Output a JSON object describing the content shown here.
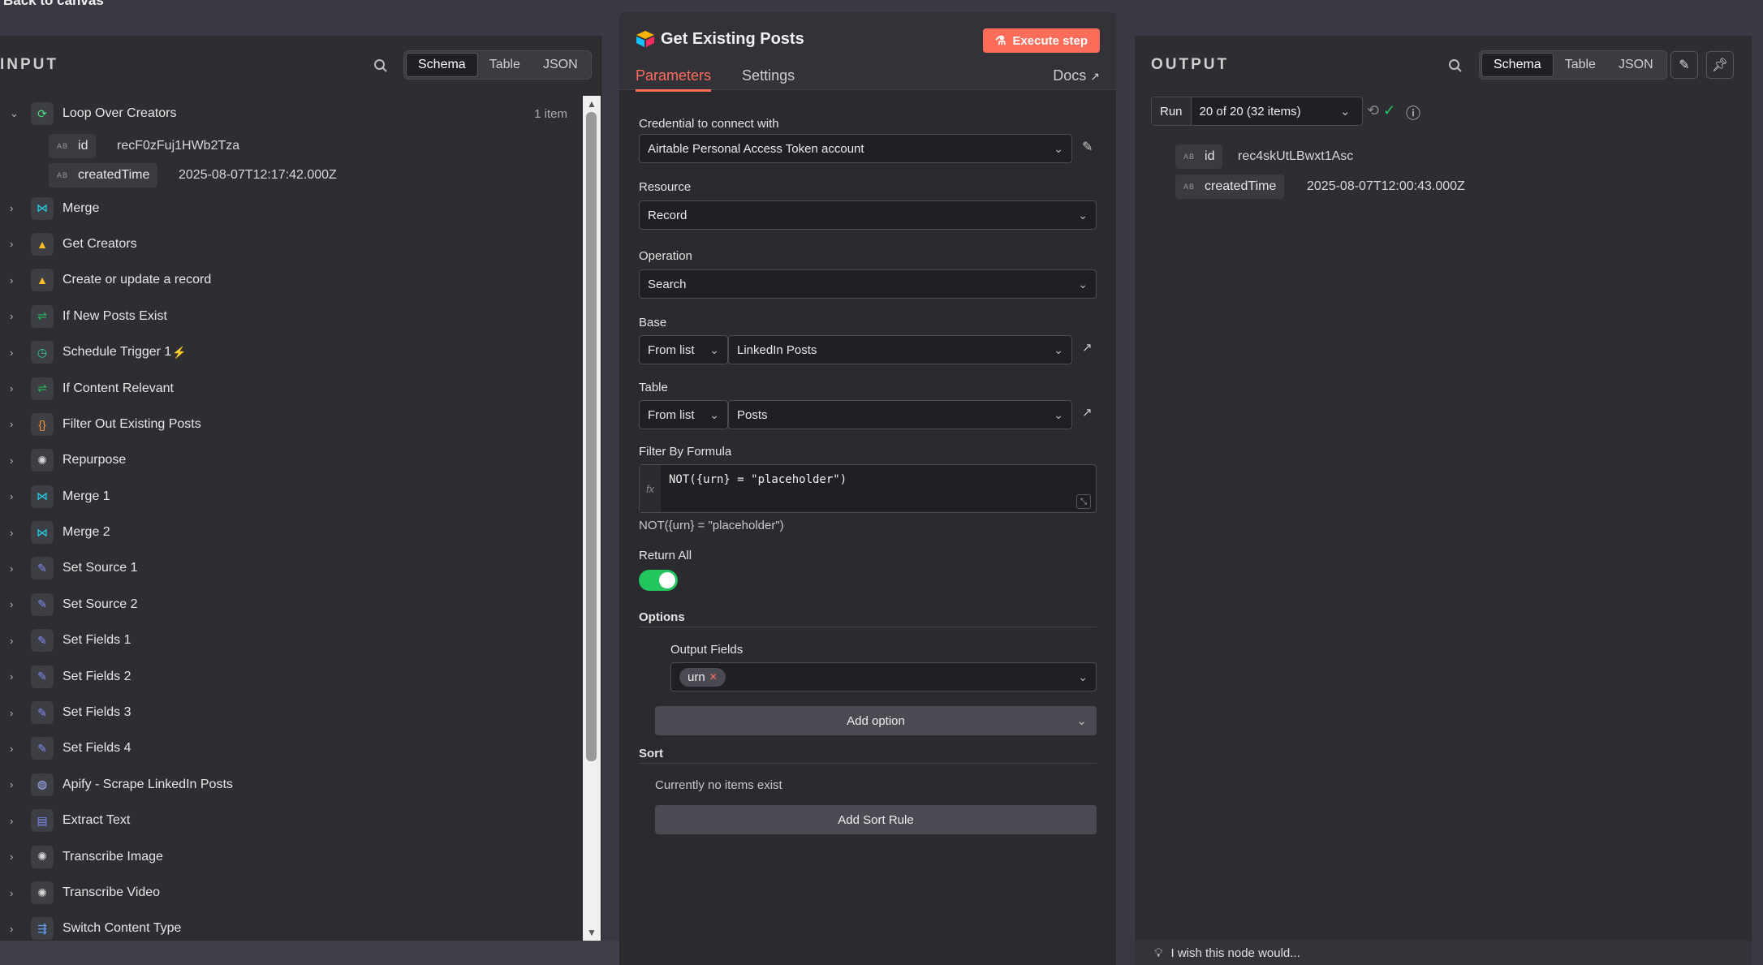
{
  "back_link": "Back to canvas",
  "input": {
    "title": "INPUT",
    "view_tabs": [
      "Schema",
      "Table",
      "JSON"
    ],
    "active_view": "Schema",
    "nodes": [
      {
        "label": "Loop Over Creators",
        "count": "1 item",
        "expanded": true,
        "icon": "loop-icon",
        "color": "#4ade80",
        "fields": [
          {
            "type": "AB",
            "name": "id",
            "value": "recF0zFuj1HWb2Tza"
          },
          {
            "type": "AB",
            "name": "createdTime",
            "value": "2025-08-07T12:17:42.000Z"
          }
        ]
      },
      {
        "label": "Merge",
        "icon": "merge-icon",
        "color": "#22d3ee"
      },
      {
        "label": "Get Creators",
        "icon": "airtable-icon",
        "color": "#fbbf24"
      },
      {
        "label": "Create or update a record",
        "icon": "airtable-icon",
        "color": "#fbbf24"
      },
      {
        "label": "If New Posts Exist",
        "icon": "if-icon",
        "color": "#22c55e"
      },
      {
        "label": "Schedule Trigger 1",
        "icon": "clock-icon",
        "color": "#34d399",
        "trigger": true
      },
      {
        "label": "If Content Relevant",
        "icon": "if-icon",
        "color": "#22c55e"
      },
      {
        "label": "Filter Out Existing Posts",
        "icon": "code-icon",
        "color": "#fb923c"
      },
      {
        "label": "Repurpose",
        "icon": "openai-icon",
        "color": "#d4d4d4"
      },
      {
        "label": "Merge 1",
        "icon": "merge-icon",
        "color": "#22d3ee"
      },
      {
        "label": "Merge 2",
        "icon": "merge-icon",
        "color": "#22d3ee"
      },
      {
        "label": "Set Source 1",
        "icon": "pencil-icon",
        "color": "#818cf8"
      },
      {
        "label": "Set Source 2",
        "icon": "pencil-icon",
        "color": "#818cf8"
      },
      {
        "label": "Set Fields 1",
        "icon": "pencil-icon",
        "color": "#818cf8"
      },
      {
        "label": "Set Fields 2",
        "icon": "pencil-icon",
        "color": "#818cf8"
      },
      {
        "label": "Set Fields 3",
        "icon": "pencil-icon",
        "color": "#818cf8"
      },
      {
        "label": "Set Fields 4",
        "icon": "pencil-icon",
        "color": "#818cf8"
      },
      {
        "label": "Apify - Scrape LinkedIn Posts",
        "icon": "globe-icon",
        "color": "#a5b4fc"
      },
      {
        "label": "Extract Text",
        "icon": "file-icon",
        "color": "#818cf8"
      },
      {
        "label": "Transcribe Image",
        "icon": "openai-icon",
        "color": "#d4d4d4"
      },
      {
        "label": "Transcribe Video",
        "icon": "openai-icon",
        "color": "#d4d4d4"
      },
      {
        "label": "Switch Content Type",
        "icon": "switch-icon",
        "color": "#60a5fa"
      }
    ]
  },
  "node": {
    "title": "Get Existing Posts",
    "execute_label": "Execute step",
    "tabs": [
      "Parameters",
      "Settings"
    ],
    "active_tab": "Parameters",
    "docs_label": "Docs",
    "credential_label": "Credential to connect with",
    "credential_value": "Airtable Personal Access Token account",
    "resource_label": "Resource",
    "resource_value": "Record",
    "operation_label": "Operation",
    "operation_value": "Search",
    "base_label": "Base",
    "base_mode": "From list",
    "base_value": "LinkedIn Posts",
    "table_label": "Table",
    "table_mode": "From list",
    "table_value": "Posts",
    "formula_label": "Filter By Formula",
    "formula_value": "NOT({urn} = \"placeholder\")",
    "formula_preview": "NOT({urn} = \"placeholder\")",
    "return_all_label": "Return All",
    "return_all": true,
    "options_label": "Options",
    "output_fields_label": "Output Fields",
    "output_fields_chip": "urn",
    "add_option_label": "Add option",
    "sort_label": "Sort",
    "sort_empty": "Currently no items exist",
    "add_sort_label": "Add Sort Rule"
  },
  "output": {
    "title": "OUTPUT",
    "view_tabs": [
      "Schema",
      "Table",
      "JSON"
    ],
    "active_view": "Schema",
    "run_label": "Run",
    "run_value": "20 of 20 (32 items)",
    "fields": [
      {
        "type": "AB",
        "name": "id",
        "value": "rec4skUtLBwxt1Asc"
      },
      {
        "type": "AB",
        "name": "createdTime",
        "value": "2025-08-07T12:00:43.000Z"
      }
    ],
    "footer": "I wish this node would..."
  }
}
